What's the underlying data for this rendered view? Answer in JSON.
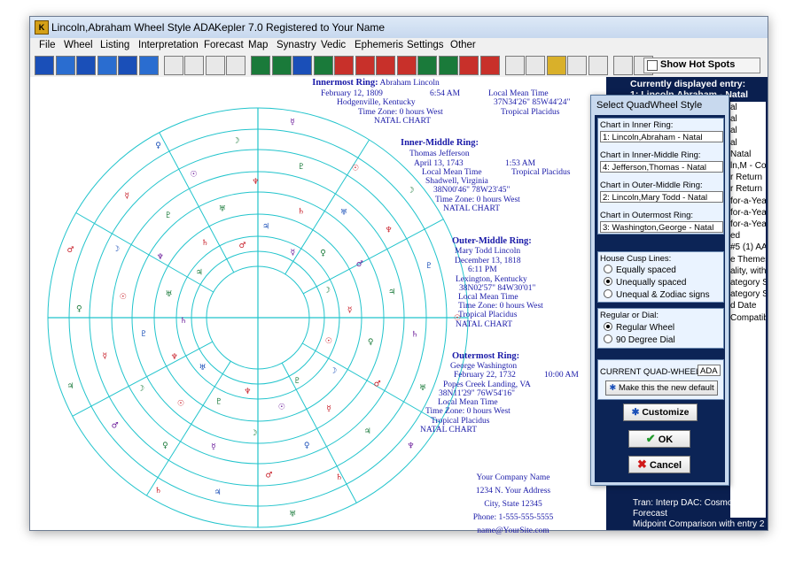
{
  "window": {
    "title": "Lincoln,Abraham Wheel Style ADA",
    "version": "Kepler 7.0",
    "registration": "Registered to Your Name"
  },
  "menu": [
    "File",
    "Wheel",
    "Listing",
    "Interpretation",
    "Forecast",
    "Map",
    "Synastry",
    "Vedic",
    "Ephemeris",
    "Settings",
    "Other"
  ],
  "toolbar": {
    "buttons": [
      "new",
      "open",
      "retrograde",
      "chart",
      "comp",
      "calc",
      "page",
      "save",
      "print",
      "mail",
      "wheel",
      "quad",
      "dual",
      "midpoint",
      "list",
      "interp",
      "forecast",
      "maps",
      "synastry",
      "vedic",
      "ephemeris",
      "settings",
      "clock",
      "calendar",
      "help",
      "text",
      "calendar2",
      "zoom-in",
      "zoom-out"
    ],
    "hotspots_label": "Show Hot Spots"
  },
  "chart_info": {
    "inner": {
      "heading": "Innermost Ring:",
      "name": "Abraham Lincoln",
      "date": "February 12, 1809",
      "time": "6:54 AM",
      "place": "Hodgenville, Kentucky",
      "timezone": "Time Zone: 0 hours West",
      "chart_type": "NATAL CHART",
      "mean_time": "Local Mean Time",
      "coords": "37N34'26\"  85W44'24\"",
      "houses": "Tropical Placidus"
    },
    "inner_middle": {
      "heading": "Inner-Middle Ring:",
      "name": "Thomas Jefferson",
      "date": "April 13, 1743",
      "time": "1:53 AM",
      "mean_time": "Local Mean Time",
      "houses": "Tropical Placidus",
      "place": "Shadwell, Virginia",
      "coords": "38N00'46\"  78W23'45\"",
      "timezone": "Time Zone: 0 hours West",
      "chart_type": "NATAL CHART"
    },
    "outer_middle": {
      "heading": "Outer-Middle Ring:",
      "name": "Mary Todd Lincoln",
      "date": "December 13, 1818",
      "time": "6:11 PM",
      "place": "Lexington, Kentucky",
      "coords": "38N02'57\"  84W30'01\"",
      "mean_time": "Local Mean Time",
      "timezone": "Time Zone: 0 hours West",
      "houses": "Tropical Placidus",
      "chart_type": "NATAL CHART"
    },
    "outermost": {
      "heading": "Outermost Ring:",
      "name": "George Washington",
      "date": "February 22, 1732",
      "time": "10:00 AM",
      "place": "Popes Creek Landing, VA",
      "coords": "38N11'29\"  76W54'16\"",
      "mean_time": "Local Mean Time",
      "timezone": "Time Zone: 0 hours West",
      "houses": "Tropical Placidus",
      "chart_type": "NATAL CHART"
    }
  },
  "company": {
    "name": "Your Company Name",
    "address": "1234 N. Your Address",
    "city": "City, State 12345",
    "phone": "Phone: 1-555-555-5555",
    "email": "name@YourSite.com"
  },
  "right_panel": {
    "heading": "Currently displayed entry:",
    "entry": "1: Lincoln,Abraham - Natal",
    "list": [
      "al",
      "al",
      "",
      "al",
      "",
      "al",
      "",
      "Natal",
      "ln,M - Co",
      "r Return",
      "r Return",
      "for-a-Yea",
      "for-a-Yea",
      "for-a-Yea",
      "",
      "",
      "",
      "ed",
      "#5 (1) AA",
      "",
      "",
      "",
      "",
      "",
      "",
      "",
      "e Themes",
      "ality, with",
      "ategory S",
      "ategory S",
      "d Date",
      "Compatib"
    ],
    "bottom_lines": [
      "Tran: Interp DAC: Cosmo Forecast",
      "Midpoint Comparison  with entry 2"
    ]
  },
  "dialog": {
    "title": "Select QuadWheel Style",
    "inner_label": "Chart in Inner Ring:",
    "inner_value": "1: Lincoln,Abraham - Natal",
    "inner_middle_label": "Chart in Inner-Middle Ring:",
    "inner_middle_value": "4: Jefferson,Thomas - Natal",
    "outer_middle_label": "Chart in Outer-Middle Ring:",
    "outer_middle_value": "2: Lincoln,Mary Todd - Natal",
    "outermost_label": "Chart in Outermost Ring:",
    "outermost_value": "3: Washington,George - Natal",
    "cusp_heading": "House Cusp Lines:",
    "cusp_opt1": "Equally spaced",
    "cusp_opt2": "Unequally spaced",
    "cusp_opt3": "Unequal & Zodiac signs",
    "dial_heading": "Regular or Dial:",
    "dial_opt1": "Regular Wheel",
    "dial_opt2": "90 Degree Dial",
    "current_label": "CURRENT QUAD-WHEEL",
    "current_value": "ADA",
    "make_default": "Make this the new default",
    "customize": "Customize",
    "ok": "OK",
    "cancel": "Cancel"
  }
}
